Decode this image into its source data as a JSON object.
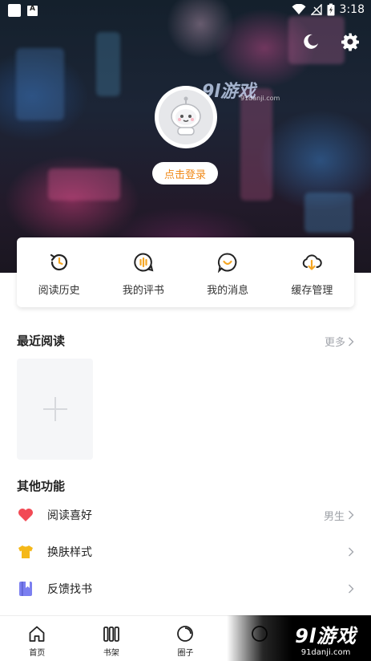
{
  "status_bar": {
    "time": "3:18"
  },
  "profile": {
    "login_label": "点击登录"
  },
  "watermark": {
    "logo_text": "9l游戏",
    "site": "91danji.com"
  },
  "quick_actions": [
    {
      "label": "阅读历史",
      "icon": "history-icon"
    },
    {
      "label": "我的评书",
      "icon": "review-icon"
    },
    {
      "label": "我的消息",
      "icon": "message-icon"
    },
    {
      "label": "缓存管理",
      "icon": "cache-download-icon"
    }
  ],
  "recent": {
    "title": "最近阅读",
    "more_label": "更多"
  },
  "other": {
    "title": "其他功能",
    "items": [
      {
        "label": "阅读喜好",
        "value": "男生",
        "icon": "heart-icon",
        "color": "#f24a55"
      },
      {
        "label": "换肤样式",
        "value": "",
        "icon": "shirt-icon",
        "color": "#f5b818"
      },
      {
        "label": "反馈找书",
        "value": "",
        "icon": "book-icon",
        "color": "#7b7ff0"
      }
    ]
  },
  "bottom_nav": [
    {
      "label": "首页",
      "icon": "home-icon"
    },
    {
      "label": "书架",
      "icon": "bookshelf-icon"
    },
    {
      "label": "圈子",
      "icon": "circle-icon"
    },
    {
      "label": "",
      "icon": "discover-icon"
    },
    {
      "label": "",
      "icon": "profile-icon"
    }
  ],
  "colors": {
    "accent": "#f08a1a",
    "muted": "#a4a7ad"
  }
}
